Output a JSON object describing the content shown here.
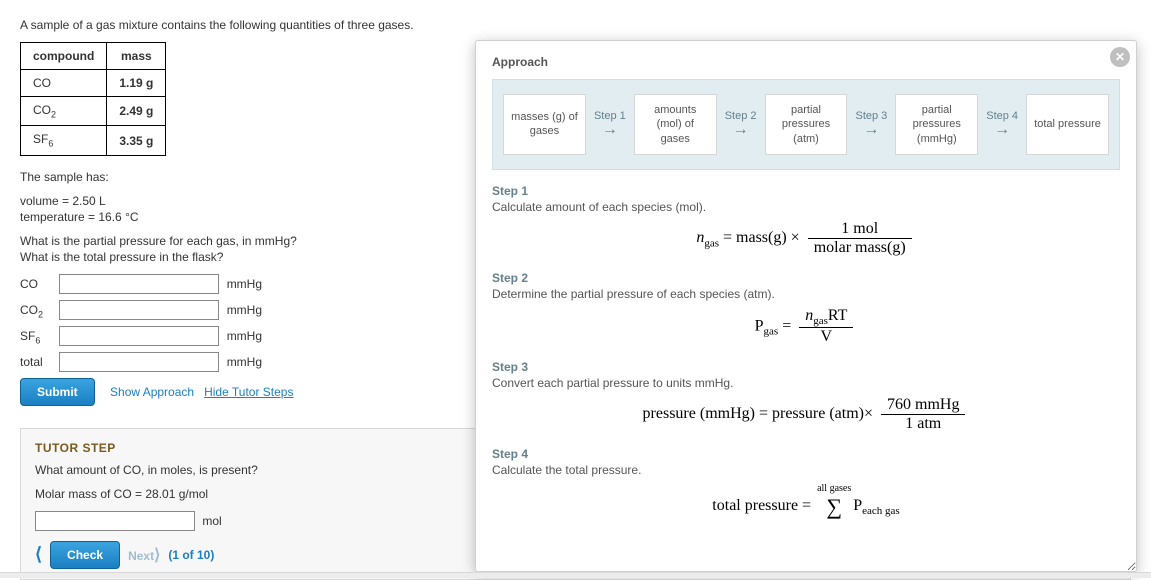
{
  "question": {
    "intro": "A sample of a gas mixture contains the following quantities of three gases.",
    "table": {
      "head_compound": "compound",
      "head_mass": "mass",
      "rows": [
        {
          "compound_html": "CO",
          "mass": "1.19 g"
        },
        {
          "compound_html": "CO2",
          "mass": "2.49 g"
        },
        {
          "compound_html": "SF6",
          "mass": "3.35 g"
        }
      ]
    },
    "sample_has": "The sample has:",
    "volume": "volume = 2.50 L",
    "temperature": "temperature = 16.6 °C",
    "q1": "What is the partial pressure for each gas, in mmHg?",
    "q2": "What is the total pressure in the flask?",
    "answers": {
      "co_label": "CO",
      "co2_label": "CO2",
      "sf6_label": "SF6",
      "total_label": "total",
      "unit": "mmHg"
    },
    "submit": "Submit",
    "show_approach": "Show Approach",
    "hide_tutor": "Hide Tutor Steps"
  },
  "tutor": {
    "heading": "TUTOR STEP",
    "prompt": "What amount of CO, in moles, is present?",
    "molar": "Molar mass of CO = 28.01 g/mol",
    "unit": "mol",
    "check": "Check",
    "next": "Next",
    "counter": "(1 of 10)"
  },
  "approach": {
    "title": "Approach",
    "flow": {
      "b1": "masses (g) of gases",
      "s1": "Step 1",
      "b2": "amounts (mol) of gases",
      "s2": "Step 2",
      "b3": "partial pressures (atm)",
      "s3": "Step 3",
      "b4": "partial pressures (mmHg)",
      "s4": "Step 4",
      "b5": "total pressure"
    },
    "steps": {
      "s1t": "Step 1",
      "s1d": "Calculate amount of each species (mol).",
      "s2t": "Step 2",
      "s2d": "Determine the partial pressure of each species (atm).",
      "s3t": "Step 3",
      "s3d": "Convert each partial pressure to units mmHg.",
      "s4t": "Step 4",
      "s4d": "Calculate the total pressure."
    }
  }
}
